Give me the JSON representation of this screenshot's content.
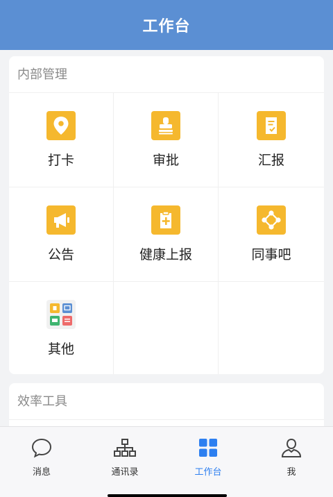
{
  "header": {
    "title": "工作台"
  },
  "internal": {
    "title": "内部管理",
    "items": [
      {
        "label": "打卡",
        "icon": "location-pin-icon"
      },
      {
        "label": "审批",
        "icon": "stamp-icon"
      },
      {
        "label": "汇报",
        "icon": "report-icon"
      },
      {
        "label": "公告",
        "icon": "megaphone-icon"
      },
      {
        "label": "健康上报",
        "icon": "health-clipboard-icon"
      },
      {
        "label": "同事吧",
        "icon": "network-icon"
      },
      {
        "label": "其他",
        "icon": "apps-grid-icon"
      }
    ]
  },
  "efficiency": {
    "title": "效率工具"
  },
  "tabs": [
    {
      "label": "消息",
      "icon": "chat-bubble-icon"
    },
    {
      "label": "通讯录",
      "icon": "org-chart-icon"
    },
    {
      "label": "工作台",
      "icon": "workbench-grid-icon",
      "active": true
    },
    {
      "label": "我",
      "icon": "person-icon"
    }
  ],
  "colors": {
    "header": "#5b8fd3",
    "tile": "#f5b82e",
    "active_tab": "#2d7ff0"
  }
}
